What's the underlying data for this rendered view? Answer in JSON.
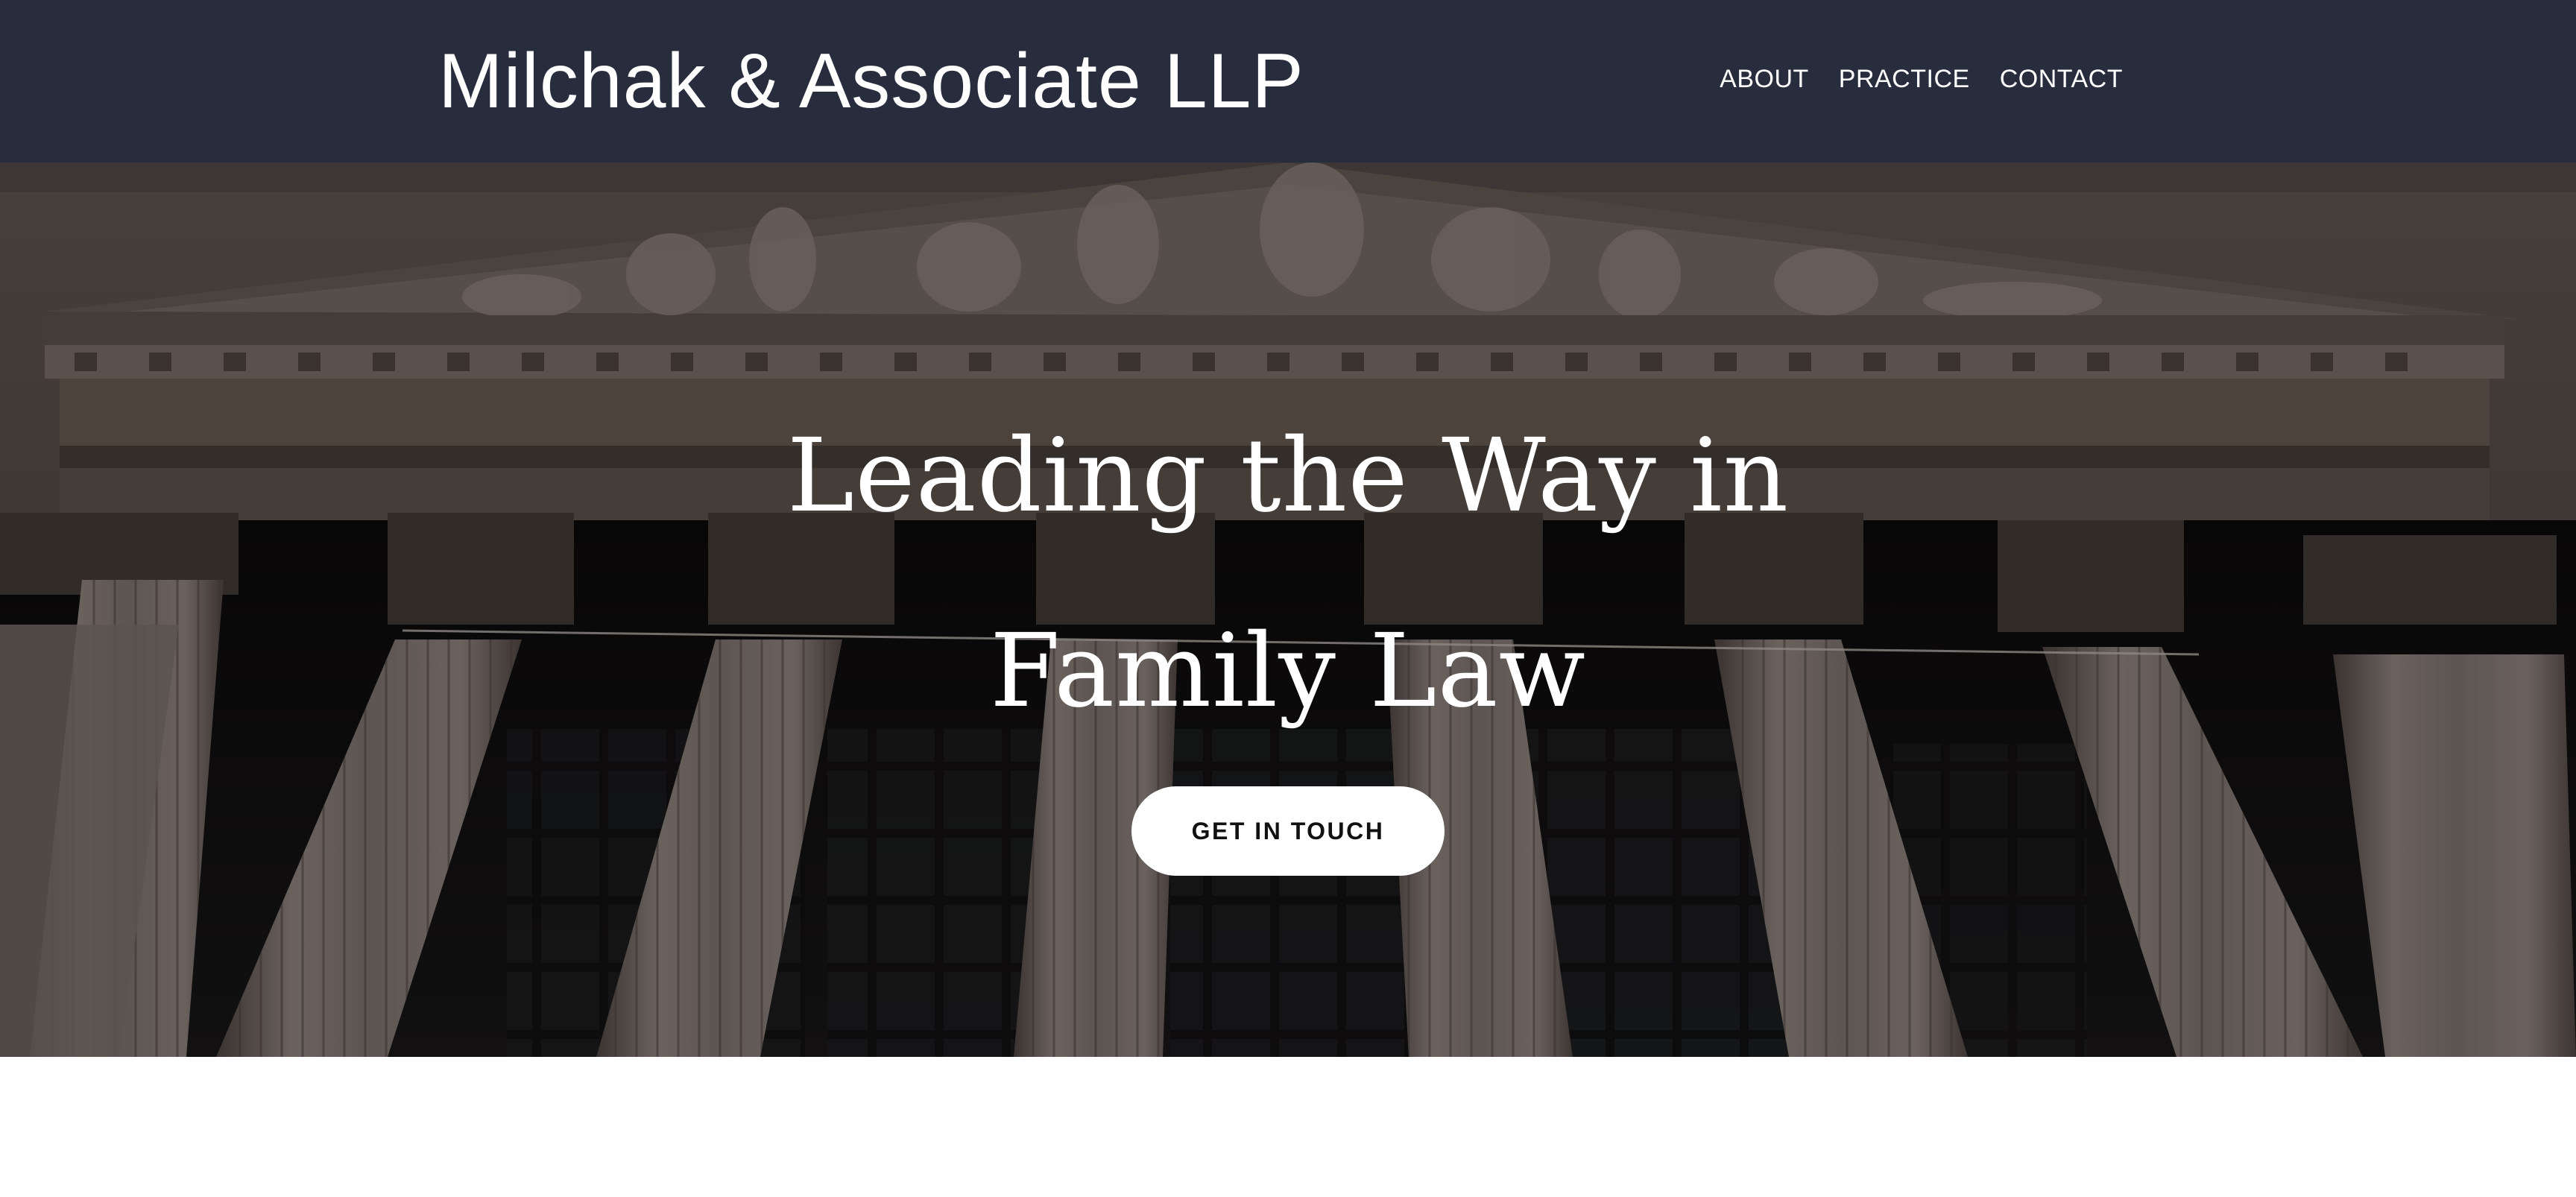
{
  "header": {
    "site_title": "Milchak & Associate LLP",
    "nav": [
      {
        "label": "ABOUT"
      },
      {
        "label": "PRACTICE"
      },
      {
        "label": "CONTACT"
      }
    ],
    "background_color": "#282d3d"
  },
  "hero": {
    "heading": "Leading the Way in Family Law",
    "cta_label": "GET IN TOUCH",
    "image_subject": "courthouse-facade-columns"
  }
}
